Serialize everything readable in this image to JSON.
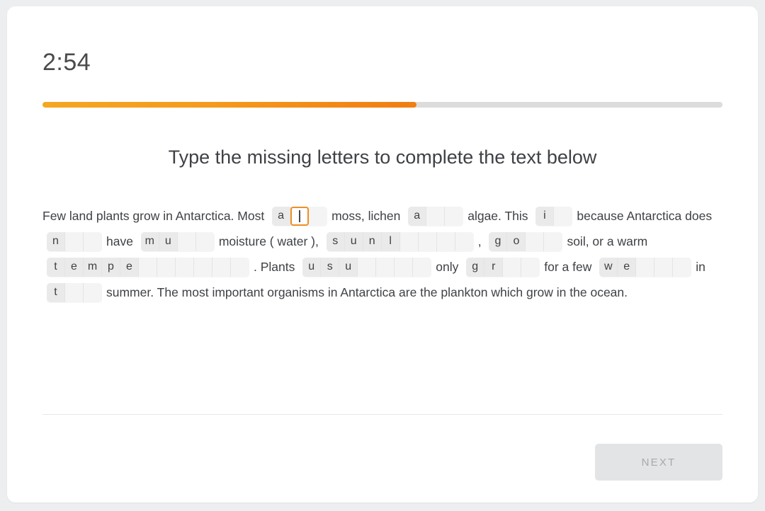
{
  "timer": "2:54",
  "progress": {
    "percent": 55,
    "fill_color": "#f59a1c",
    "track_color": "#dcdcdc"
  },
  "heading": "Type the missing letters to complete the text below",
  "exercise": {
    "segments": [
      {
        "kind": "text",
        "value": "Few land plants grow in Antarctica. Most"
      },
      {
        "kind": "blank",
        "cells": [
          "a",
          "",
          ""
        ],
        "active_index": 1
      },
      {
        "kind": "text",
        "value": "moss, lichen"
      },
      {
        "kind": "blank",
        "cells": [
          "a",
          "",
          ""
        ]
      },
      {
        "kind": "text",
        "value": "algae. This"
      },
      {
        "kind": "blank",
        "cells": [
          "i",
          ""
        ]
      },
      {
        "kind": "text",
        "value": "because Antarctica does"
      },
      {
        "kind": "blank",
        "cells": [
          "n",
          "",
          ""
        ]
      },
      {
        "kind": "text",
        "value": "have"
      },
      {
        "kind": "blank",
        "cells": [
          "m",
          "u",
          "",
          ""
        ]
      },
      {
        "kind": "text",
        "value": "moisture ( water ),"
      },
      {
        "kind": "blank",
        "cells": [
          "s",
          "u",
          "n",
          "l",
          "",
          "",
          "",
          ""
        ]
      },
      {
        "kind": "text",
        "value": ","
      },
      {
        "kind": "blank",
        "cells": [
          "g",
          "o",
          "",
          ""
        ]
      },
      {
        "kind": "text",
        "value": "soil, or a warm"
      },
      {
        "kind": "blank",
        "cells": [
          "t",
          "e",
          "m",
          "p",
          "e",
          "",
          "",
          "",
          "",
          "",
          ""
        ]
      },
      {
        "kind": "text",
        "value": ". Plants"
      },
      {
        "kind": "blank",
        "cells": [
          "u",
          "s",
          "u",
          "",
          "",
          "",
          ""
        ]
      },
      {
        "kind": "text",
        "value": "only"
      },
      {
        "kind": "blank",
        "cells": [
          "g",
          "r",
          "",
          ""
        ]
      },
      {
        "kind": "text",
        "value": "for a few"
      },
      {
        "kind": "blank",
        "cells": [
          "w",
          "e",
          "",
          "",
          ""
        ]
      },
      {
        "kind": "text",
        "value": "in"
      },
      {
        "kind": "blank",
        "cells": [
          "t",
          "",
          ""
        ]
      },
      {
        "kind": "text",
        "value": "summer. The most important organisms in Antarctica are the plankton which grow in the ocean."
      }
    ]
  },
  "next_button": {
    "label": "NEXT",
    "disabled": true
  }
}
